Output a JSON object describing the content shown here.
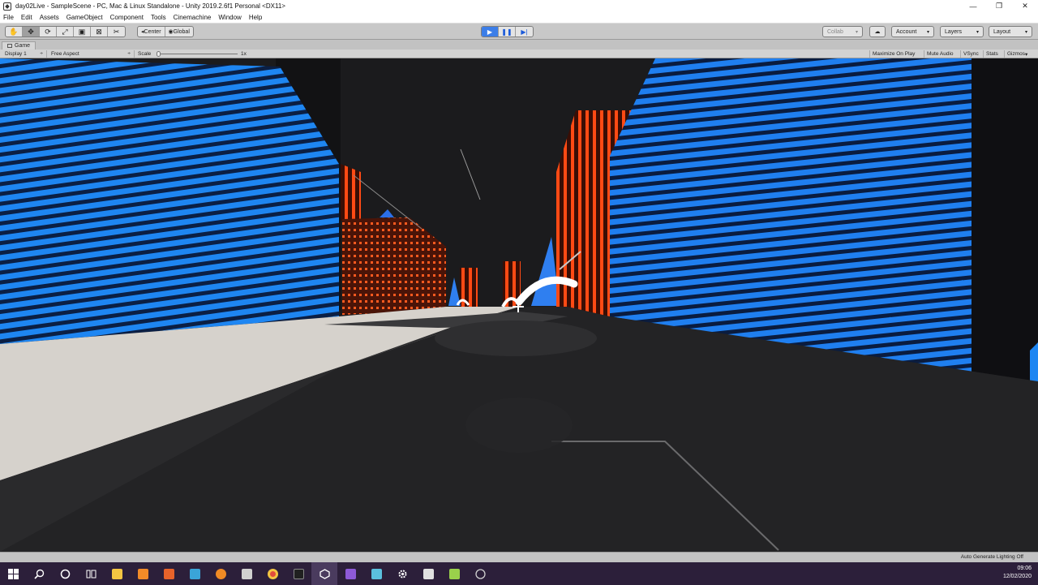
{
  "window": {
    "title": "day02Live - SampleScene - PC, Mac & Linux Standalone - Unity 2019.2.6f1 Personal <DX11>",
    "minimize_glyph": "—",
    "restore_glyph": "❐",
    "close_glyph": "✕"
  },
  "menu": {
    "items": [
      "File",
      "Edit",
      "Assets",
      "GameObject",
      "Component",
      "Tools",
      "Cinemachine",
      "Window",
      "Help"
    ]
  },
  "toolbar": {
    "tools": [
      {
        "icon": "hand-tool-icon",
        "glyph": "✋"
      },
      {
        "icon": "move-tool-icon",
        "glyph": "✥"
      },
      {
        "icon": "rotate-tool-icon",
        "glyph": "⟳"
      },
      {
        "icon": "scale-tool-icon",
        "glyph": "⤢"
      },
      {
        "icon": "rect-tool-icon",
        "glyph": "▣"
      },
      {
        "icon": "transform-tool-icon",
        "glyph": "⊠"
      },
      {
        "icon": "custom-tool-icon",
        "glyph": "✂"
      }
    ],
    "pivot": "Center",
    "pivot_glyph": "◂",
    "rotation": "Global",
    "rotation_glyph": "◉",
    "play_glyph": "▶",
    "pause_glyph": "❚❚",
    "step_glyph": "▶|",
    "collab_label": "Collab",
    "cloud_glyph": "☁",
    "account_label": "Account",
    "layers_label": "Layers",
    "layout_label": "Layout",
    "caret": "▾"
  },
  "game_tab": {
    "label": "Game"
  },
  "game_header": {
    "display": "Display 1",
    "aspect": "Free Aspect",
    "scale_label": "Scale",
    "scale_value": "1x",
    "maximize_on_play": "Maximize On Play",
    "mute_audio": "Mute Audio",
    "vsync": "VSync",
    "stats": "Stats",
    "gizmos": "Gizmos",
    "caret": "▾",
    "stepper": "÷"
  },
  "status": {
    "text": "Auto Generate Lighting Off"
  },
  "taskbar": {
    "icons": [
      {
        "name": "windows-start-icon",
        "color": "#ffffff"
      },
      {
        "name": "search-icon",
        "color": "#ffffff"
      },
      {
        "name": "cortana-icon",
        "color": "#ffffff"
      },
      {
        "name": "task-view-icon",
        "color": "#ffffff"
      },
      {
        "name": "file-explorer-icon",
        "color": "#f4c542"
      },
      {
        "name": "sublime-text-icon",
        "color": "#f28b28"
      },
      {
        "name": "app-orange-icon",
        "color": "#e8632a"
      },
      {
        "name": "notes-icon",
        "color": "#3aa4d8"
      },
      {
        "name": "blender-icon",
        "color": "#f08a24"
      },
      {
        "name": "document-icon",
        "color": "#d0d0d0"
      },
      {
        "name": "chrome-icon",
        "color": "#e24c3c"
      },
      {
        "name": "terminal-icon",
        "color": "#202020"
      },
      {
        "name": "unity-icon",
        "color": "#ffffff"
      },
      {
        "name": "visual-studio-icon",
        "color": "#8e5ad8"
      },
      {
        "name": "paint-icon",
        "color": "#5bc0de"
      },
      {
        "name": "settings-icon",
        "color": "#ffffff"
      },
      {
        "name": "calculator-icon",
        "color": "#e0e0e0"
      },
      {
        "name": "krita-icon",
        "color": "#9ad14b"
      },
      {
        "name": "obs-icon",
        "color": "#cfcfcf"
      }
    ],
    "time": "09:06",
    "date": "12/02/2020"
  },
  "scene_colors": {
    "neon_blue": "#1e86f2",
    "neon_orange": "#ff5a1f",
    "ground": "#d6d2cc",
    "road": "#232325",
    "sky": "#1b1b1d"
  }
}
